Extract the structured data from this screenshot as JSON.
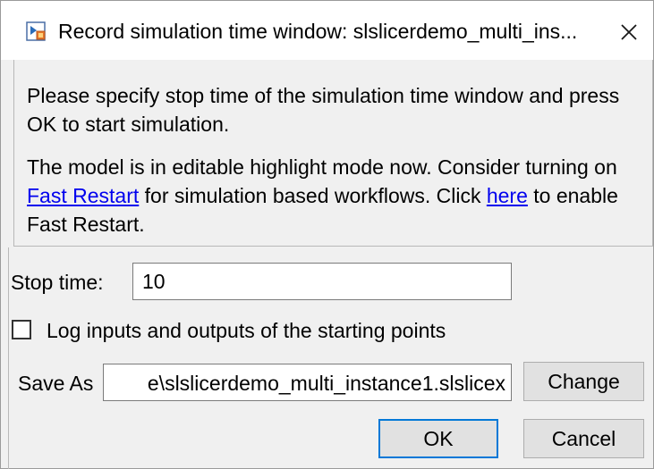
{
  "window": {
    "title": "Record simulation time window: slslicerdemo_multi_ins...",
    "icon": "simulink-app-icon",
    "close_icon": "close-icon"
  },
  "info": {
    "line1": "Please specify stop time of the simulation time window and press OK to start simulation.",
    "line2_before": "The model is in editable highlight mode now. Consider turning on ",
    "fast_restart_link": "Fast Restart",
    "line2_middle": " for simulation based workflows. Click ",
    "here_link": "here",
    "line2_after": " to enable Fast Restart."
  },
  "form": {
    "stop_time_label": "Stop time:",
    "stop_time_value": "10",
    "log_checkbox_label": "Log inputs and outputs of the starting points",
    "log_checkbox_checked": false,
    "save_as_label": "Save As",
    "save_as_value": "e\\slslicerdemo_multi_instance1.slslicex",
    "change_button": "Change"
  },
  "buttons": {
    "ok": "OK",
    "cancel": "Cancel"
  },
  "colors": {
    "link": "#0000ee",
    "default_button_border": "#0078d7",
    "panel_background": "#f0f0f0"
  }
}
